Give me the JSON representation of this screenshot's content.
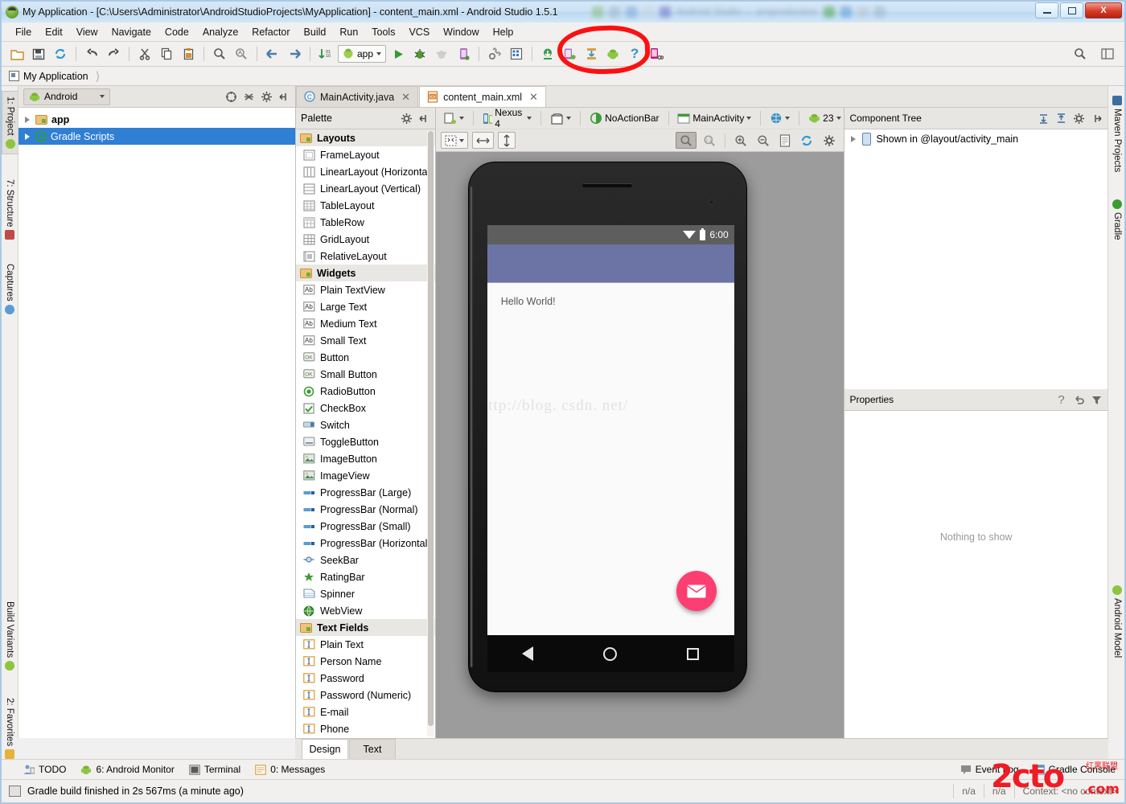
{
  "window": {
    "title": "My Application - [C:\\Users\\Administrator\\AndroidStudioProjects\\MyApplication] - content_main.xml - Android Studio 1.5.1",
    "ghost_text": "Android Studio — preproduction",
    "minimize_label": "Minimize",
    "maximize_label": "Maximize",
    "close_label": "X"
  },
  "menubar": {
    "items": [
      {
        "label": "File",
        "mnemonic": "F"
      },
      {
        "label": "Edit",
        "mnemonic": "E"
      },
      {
        "label": "View",
        "mnemonic": "V"
      },
      {
        "label": "Navigate",
        "mnemonic": "N"
      },
      {
        "label": "Code",
        "mnemonic": "C"
      },
      {
        "label": "Analyze",
        "mnemonic": "z"
      },
      {
        "label": "Refactor",
        "mnemonic": "R"
      },
      {
        "label": "Build",
        "mnemonic": "B"
      },
      {
        "label": "Run",
        "mnemonic": "u"
      },
      {
        "label": "Tools",
        "mnemonic": "T"
      },
      {
        "label": "VCS",
        "mnemonic": "S"
      },
      {
        "label": "Window",
        "mnemonic": "W"
      },
      {
        "label": "Help",
        "mnemonic": "H"
      }
    ]
  },
  "toolbar": {
    "run_config": "app",
    "icons": [
      "open-folder-icon",
      "save-all-icon",
      "sync-icon",
      "undo-icon",
      "redo-icon",
      "cut-icon",
      "copy-icon",
      "paste-icon",
      "find-icon",
      "replace-icon",
      "back-icon",
      "forward-icon",
      "compile-icon"
    ],
    "right_icons": [
      "run-icon",
      "debug-icon",
      "coverage-icon",
      "attach-debugger-icon",
      "sdk-manager-icon",
      "avd-manager-icon",
      "sync-gradle-icon",
      "avd-icon",
      "sdk-download-icon",
      "android-icon",
      "help-icon",
      "device-monitor-icon"
    ],
    "search_icon": "search-everywhere-icon",
    "layout_icon": "layout-icon",
    "annotation": "red-circle-highlight"
  },
  "breadcrumb": {
    "items": [
      "My Application"
    ]
  },
  "left_tool_tabs": [
    {
      "label": "1: Project",
      "selected": true,
      "icon": "android-icon"
    },
    {
      "label": "7: Structure",
      "selected": false,
      "icon": "structure-icon"
    },
    {
      "label": "Captures",
      "selected": false,
      "icon": "captures-icon"
    },
    {
      "label": "Build Variants",
      "selected": false,
      "icon": "android-icon"
    },
    {
      "label": "2: Favorites",
      "selected": false,
      "icon": "favorites-icon"
    }
  ],
  "right_tool_tabs": [
    {
      "label": "Maven Projects",
      "icon": "maven-icon"
    },
    {
      "label": "Gradle",
      "icon": "gradle-icon"
    },
    {
      "label": "Android Model",
      "icon": "android-icon"
    }
  ],
  "project_panel": {
    "view_selector": "Android",
    "header_icons": [
      "target-icon",
      "collapse-icon",
      "gear-icon",
      "hide-icon"
    ],
    "tree": [
      {
        "label": "app",
        "icon": "module-folder-icon",
        "selected": false,
        "bold": true
      },
      {
        "label": "Gradle Scripts",
        "icon": "gradle-icon",
        "selected": true,
        "bold": false
      }
    ]
  },
  "editor_tabs": [
    {
      "label": "MainActivity.java",
      "icon": "java-class-icon",
      "active": false
    },
    {
      "label": "content_main.xml",
      "icon": "xml-layout-icon",
      "active": true
    }
  ],
  "palette": {
    "title": "Palette",
    "header_icons": [
      "gear-icon",
      "hide-icon"
    ],
    "groups": [
      {
        "name": "Layouts",
        "items": [
          {
            "label": "FrameLayout",
            "icon": "frame-layout-icon"
          },
          {
            "label": "LinearLayout (Horizontal)",
            "icon": "linear-horizontal-icon"
          },
          {
            "label": "LinearLayout (Vertical)",
            "icon": "linear-vertical-icon"
          },
          {
            "label": "TableLayout",
            "icon": "table-layout-icon"
          },
          {
            "label": "TableRow",
            "icon": "table-row-icon"
          },
          {
            "label": "GridLayout",
            "icon": "grid-layout-icon"
          },
          {
            "label": "RelativeLayout",
            "icon": "relative-layout-icon"
          }
        ]
      },
      {
        "name": "Widgets",
        "items": [
          {
            "label": "Plain TextView",
            "icon": "ab-icon"
          },
          {
            "label": "Large Text",
            "icon": "ab-icon"
          },
          {
            "label": "Medium Text",
            "icon": "ab-icon"
          },
          {
            "label": "Small Text",
            "icon": "ab-icon"
          },
          {
            "label": "Button",
            "icon": "ok-button-icon"
          },
          {
            "label": "Small Button",
            "icon": "ok-button-icon"
          },
          {
            "label": "RadioButton",
            "icon": "radio-button-icon"
          },
          {
            "label": "CheckBox",
            "icon": "checkbox-icon"
          },
          {
            "label": "Switch",
            "icon": "switch-icon"
          },
          {
            "label": "ToggleButton",
            "icon": "toggle-button-icon"
          },
          {
            "label": "ImageButton",
            "icon": "image-button-icon"
          },
          {
            "label": "ImageView",
            "icon": "image-view-icon"
          },
          {
            "label": "ProgressBar (Large)",
            "icon": "progressbar-icon"
          },
          {
            "label": "ProgressBar (Normal)",
            "icon": "progressbar-icon"
          },
          {
            "label": "ProgressBar (Small)",
            "icon": "progressbar-icon"
          },
          {
            "label": "ProgressBar (Horizontal)",
            "icon": "progressbar-icon"
          },
          {
            "label": "SeekBar",
            "icon": "seekbar-icon"
          },
          {
            "label": "RatingBar",
            "icon": "star-icon"
          },
          {
            "label": "Spinner",
            "icon": "spinner-icon"
          },
          {
            "label": "WebView",
            "icon": "globe-icon"
          }
        ]
      },
      {
        "name": "Text Fields",
        "items": [
          {
            "label": "Plain Text",
            "icon": "text-field-icon"
          },
          {
            "label": "Person Name",
            "icon": "text-field-icon"
          },
          {
            "label": "Password",
            "icon": "text-field-icon"
          },
          {
            "label": "Password (Numeric)",
            "icon": "text-field-icon"
          },
          {
            "label": "E-mail",
            "icon": "text-field-icon"
          },
          {
            "label": "Phone",
            "icon": "text-field-icon"
          }
        ]
      }
    ]
  },
  "design_toolbar": {
    "row1": [
      {
        "label": "",
        "icon": "device-config-icon",
        "caret": true
      },
      {
        "label": "Nexus 4",
        "icon": "device-icon",
        "caret": true
      },
      {
        "label": "",
        "icon": "orientation-icon",
        "caret": true
      },
      {
        "label": "NoActionBar",
        "icon": "theme-icon",
        "caret": false
      },
      {
        "label": "MainActivity",
        "icon": "activity-icon",
        "caret": true
      },
      {
        "label": "",
        "icon": "locale-globe-icon",
        "caret": true
      },
      {
        "label": "23",
        "icon": "api-android-icon",
        "caret": true
      }
    ],
    "row2_left": [
      {
        "icon": "fit-zoom-icon",
        "caret": true
      },
      {
        "icon": "width-icon",
        "caret": false
      },
      {
        "icon": "height-icon",
        "caret": false
      }
    ],
    "row2_right": [
      {
        "icon": "zoom-fit-icon",
        "pressed": true
      },
      {
        "icon": "zoom-actual-icon",
        "pressed": false
      },
      {
        "icon": "zoom-in-icon",
        "pressed": false
      },
      {
        "icon": "zoom-out-icon",
        "pressed": false
      },
      {
        "icon": "document-icon",
        "pressed": false
      },
      {
        "icon": "refresh-icon",
        "pressed": false
      },
      {
        "icon": "gear-icon",
        "pressed": false
      }
    ]
  },
  "preview": {
    "device_name": "Nexus 4",
    "status_time": "6:00",
    "status_icons": [
      "wifi-icon",
      "battery-icon"
    ],
    "hello_text": "Hello World!",
    "watermark_url": "http://blog. csdn. net/",
    "fab_icon": "email-icon",
    "nav_icons": [
      "back-icon",
      "home-icon",
      "recents-icon"
    ]
  },
  "component_tree": {
    "title": "Component Tree",
    "header_icons": [
      "expand-all-icon",
      "collapse-all-icon",
      "gear-icon",
      "hide-icon"
    ],
    "rows": [
      {
        "label": "Shown in @layout/activity_main",
        "icon": "device-screen-icon"
      }
    ]
  },
  "properties": {
    "title": "Properties",
    "header_icons": [
      "help-icon",
      "revert-icon",
      "filter-icon"
    ],
    "empty_text": "Nothing to show"
  },
  "editor_mode_tabs": [
    {
      "label": "Design",
      "active": true
    },
    {
      "label": "Text",
      "active": false
    }
  ],
  "bottom_strip": {
    "left_items": [
      {
        "label": "TODO",
        "icon": "todo-icon",
        "mnemonic": ""
      },
      {
        "label": "6: Android Monitor",
        "icon": "android-icon",
        "mnemonic": "6"
      },
      {
        "label": "Terminal",
        "icon": "terminal-icon",
        "mnemonic": ""
      },
      {
        "label": "0: Messages",
        "icon": "messages-icon",
        "mnemonic": "0"
      }
    ],
    "right_items": [
      {
        "label": "Event Log",
        "icon": "event-log-icon"
      },
      {
        "label": "Gradle Console",
        "icon": "gradle-console-icon"
      }
    ]
  },
  "status_bar": {
    "message": "Gradle build finished in 2s 567ms (a minute ago)",
    "icon": "build-icon",
    "cells": [
      "n/a",
      "n/a",
      "Context: <no context>"
    ]
  },
  "watermark": {
    "brand": "2cto",
    "domain": ".com",
    "cn_text": "红黑联盟"
  },
  "colors": {
    "selection_blue": "#2f7fd4",
    "accent_pink": "#fc3e72",
    "appbar_purple": "#6b74a4",
    "annotation_red": "#fb1111",
    "watermark_red": "#ee1c25"
  }
}
